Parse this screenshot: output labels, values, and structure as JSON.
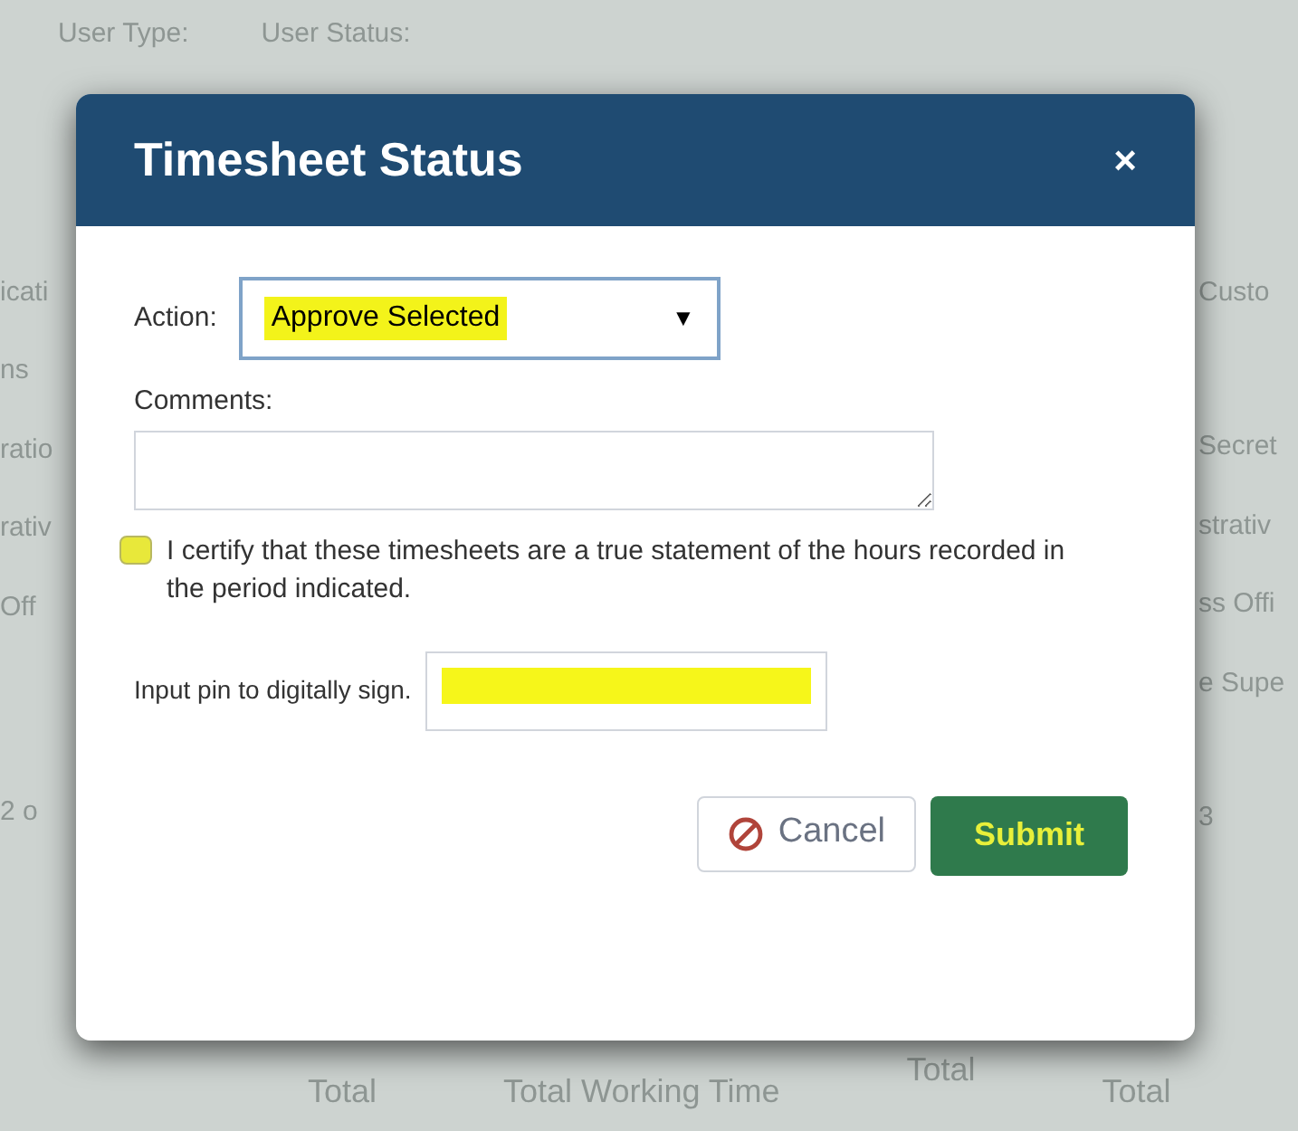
{
  "background": {
    "filters": [
      {
        "label": "User Type:"
      },
      {
        "label": "User Status:"
      }
    ],
    "left_column": [
      "icati",
      "ns",
      "ratio",
      "rativ",
      "Off",
      "2 o"
    ],
    "right_column": [
      "Custo",
      "Secret",
      "strativ",
      "ss Offi",
      "e Supe",
      "3"
    ],
    "footer_headers": [
      "Total",
      "Total Working Time",
      "Total",
      "Total"
    ]
  },
  "dialog": {
    "title": "Timesheet Status",
    "close": "×",
    "action": {
      "label": "Action:",
      "value": "Approve Selected",
      "caret": "▼",
      "highlighted": true
    },
    "comments": {
      "label": "Comments:"
    },
    "certify": {
      "checked": false,
      "highlighted": true,
      "text": "I certify that these timesheets are a true statement of the hours recorded in the period indicated."
    },
    "pin": {
      "label": "Input pin to digitally sign.",
      "highlighted": true
    },
    "buttons": [
      {
        "kind": "cancel",
        "label": "Cancel"
      },
      {
        "kind": "submit",
        "label": "Submit",
        "highlighted": true
      }
    ]
  }
}
